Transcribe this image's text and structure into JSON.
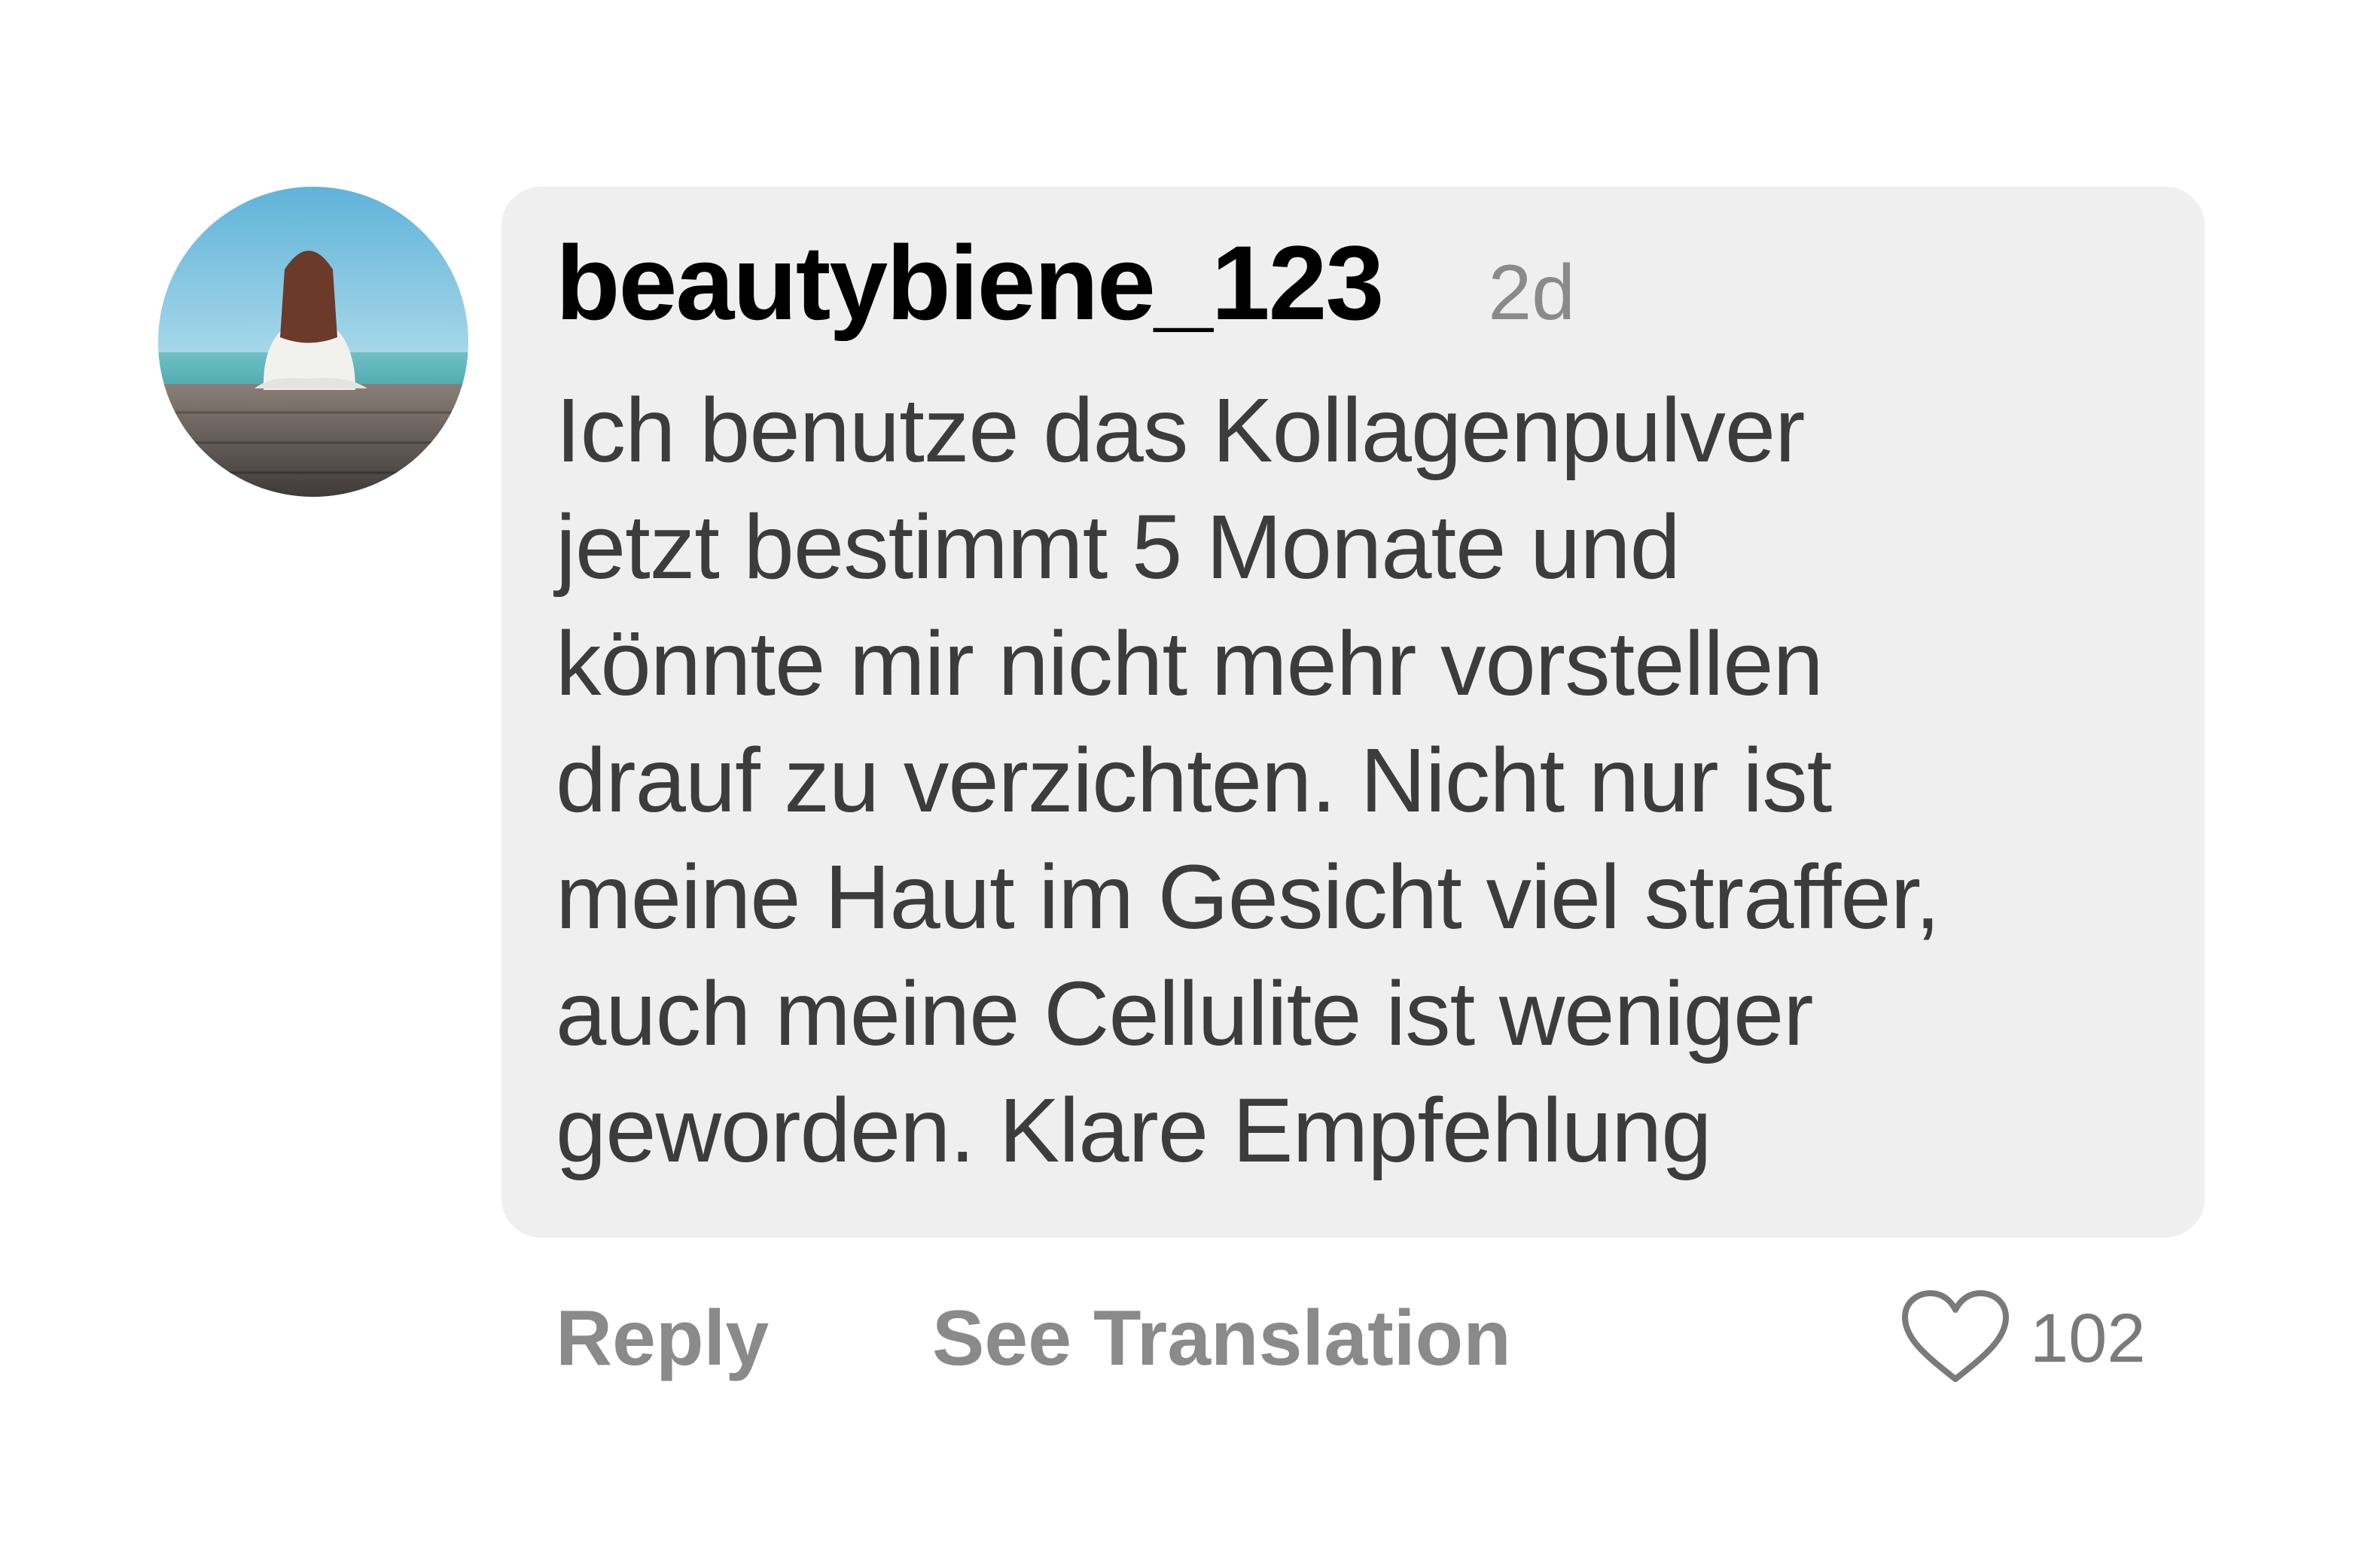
{
  "comment": {
    "username": "beautybiene_123",
    "timestamp": "2d",
    "text": "Ich benutze das Kollagenpulver\njetzt bestimmt 5 Monate und\nkönnte mir nicht mehr vorstellen\ndrauf zu verzichten. Nicht nur ist\nmeine Haut im Gesicht viel straffer,\nauch meine Cellulite ist weniger\ngeworden. Klare Empfehlung"
  },
  "actions": {
    "reply_label": "Reply",
    "translate_label": "See Translation",
    "like_count": "102",
    "like_icon": "heart-icon"
  },
  "colors": {
    "bubble_background": "#efefef",
    "username": "#000000",
    "body_text": "#3c3c3c",
    "secondary_text": "#8a8a8a"
  }
}
